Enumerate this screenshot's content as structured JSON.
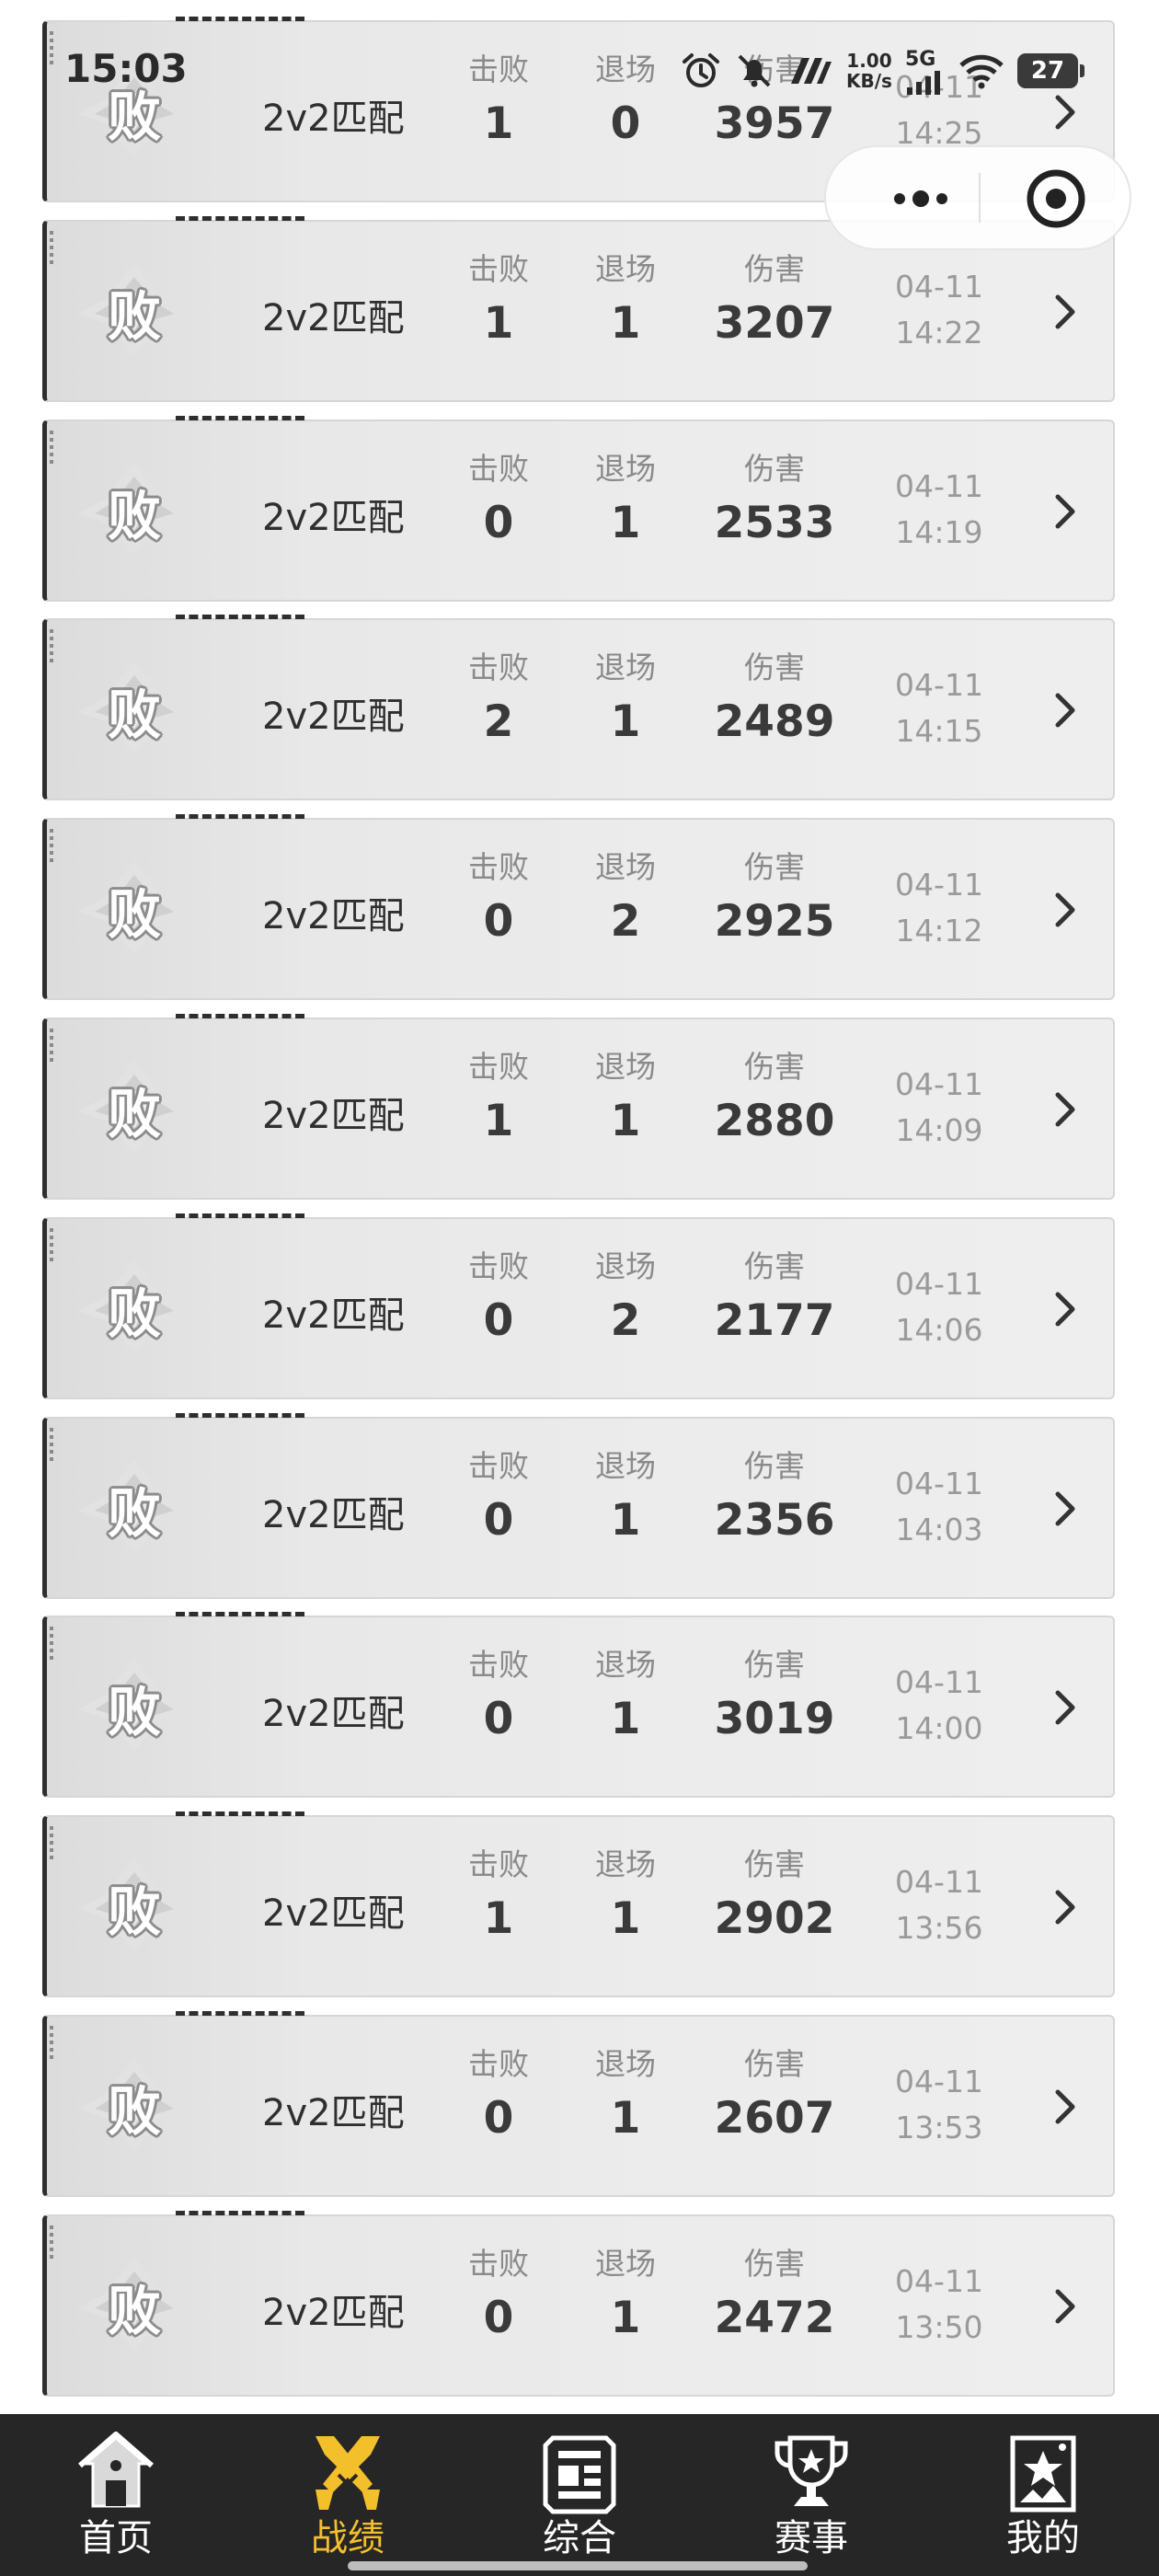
{
  "status_bar": {
    "time": "15:03",
    "net_speed_value": "1.00",
    "net_speed_unit": "KB/s",
    "network_type": "5G",
    "battery": "27"
  },
  "records": [
    {
      "result": "败",
      "mode": "2v2匹配",
      "stats": [
        {
          "label": "击败",
          "value": "1"
        },
        {
          "label": "退场",
          "value": "0"
        },
        {
          "label": "伤害",
          "value": "3957"
        }
      ],
      "date": "04-11",
      "time": "14:25"
    },
    {
      "result": "败",
      "mode": "2v2匹配",
      "stats": [
        {
          "label": "击败",
          "value": "1"
        },
        {
          "label": "退场",
          "value": "1"
        },
        {
          "label": "伤害",
          "value": "3207"
        }
      ],
      "date": "04-11",
      "time": "14:22"
    },
    {
      "result": "败",
      "mode": "2v2匹配",
      "stats": [
        {
          "label": "击败",
          "value": "0"
        },
        {
          "label": "退场",
          "value": "1"
        },
        {
          "label": "伤害",
          "value": "2533"
        }
      ],
      "date": "04-11",
      "time": "14:19"
    },
    {
      "result": "败",
      "mode": "2v2匹配",
      "stats": [
        {
          "label": "击败",
          "value": "2"
        },
        {
          "label": "退场",
          "value": "1"
        },
        {
          "label": "伤害",
          "value": "2489"
        }
      ],
      "date": "04-11",
      "time": "14:15"
    },
    {
      "result": "败",
      "mode": "2v2匹配",
      "stats": [
        {
          "label": "击败",
          "value": "0"
        },
        {
          "label": "退场",
          "value": "2"
        },
        {
          "label": "伤害",
          "value": "2925"
        }
      ],
      "date": "04-11",
      "time": "14:12"
    },
    {
      "result": "败",
      "mode": "2v2匹配",
      "stats": [
        {
          "label": "击败",
          "value": "1"
        },
        {
          "label": "退场",
          "value": "1"
        },
        {
          "label": "伤害",
          "value": "2880"
        }
      ],
      "date": "04-11",
      "time": "14:09"
    },
    {
      "result": "败",
      "mode": "2v2匹配",
      "stats": [
        {
          "label": "击败",
          "value": "0"
        },
        {
          "label": "退场",
          "value": "2"
        },
        {
          "label": "伤害",
          "value": "2177"
        }
      ],
      "date": "04-11",
      "time": "14:06"
    },
    {
      "result": "败",
      "mode": "2v2匹配",
      "stats": [
        {
          "label": "击败",
          "value": "0"
        },
        {
          "label": "退场",
          "value": "1"
        },
        {
          "label": "伤害",
          "value": "2356"
        }
      ],
      "date": "04-11",
      "time": "14:03"
    },
    {
      "result": "败",
      "mode": "2v2匹配",
      "stats": [
        {
          "label": "击败",
          "value": "0"
        },
        {
          "label": "退场",
          "value": "1"
        },
        {
          "label": "伤害",
          "value": "3019"
        }
      ],
      "date": "04-11",
      "time": "14:00"
    },
    {
      "result": "败",
      "mode": "2v2匹配",
      "stats": [
        {
          "label": "击败",
          "value": "1"
        },
        {
          "label": "退场",
          "value": "1"
        },
        {
          "label": "伤害",
          "value": "2902"
        }
      ],
      "date": "04-11",
      "time": "13:56"
    },
    {
      "result": "败",
      "mode": "2v2匹配",
      "stats": [
        {
          "label": "击败",
          "value": "0"
        },
        {
          "label": "退场",
          "value": "1"
        },
        {
          "label": "伤害",
          "value": "2607"
        }
      ],
      "date": "04-11",
      "time": "13:53"
    },
    {
      "result": "败",
      "mode": "2v2匹配",
      "stats": [
        {
          "label": "击败",
          "value": "0"
        },
        {
          "label": "退场",
          "value": "1"
        },
        {
          "label": "伤害",
          "value": "2472"
        }
      ],
      "date": "04-11",
      "time": "13:50"
    }
  ],
  "bottom_nav": {
    "items": [
      {
        "label": "首页",
        "icon": "home-icon"
      },
      {
        "label": "战绩",
        "icon": "crossed-swords-icon"
      },
      {
        "label": "综合",
        "icon": "panel-icon"
      },
      {
        "label": "赛事",
        "icon": "trophy-icon"
      },
      {
        "label": "我的",
        "icon": "profile-card-icon"
      }
    ],
    "active_index": 1
  },
  "colors": {
    "nav_background": "#262626",
    "nav_active": "#f3c02c",
    "nav_inactive": "#ffffff",
    "card_background": "#ececec",
    "card_edge": "#2e2e2e",
    "label_text": "#8a8a8a",
    "value_text": "#3a3a3a"
  }
}
